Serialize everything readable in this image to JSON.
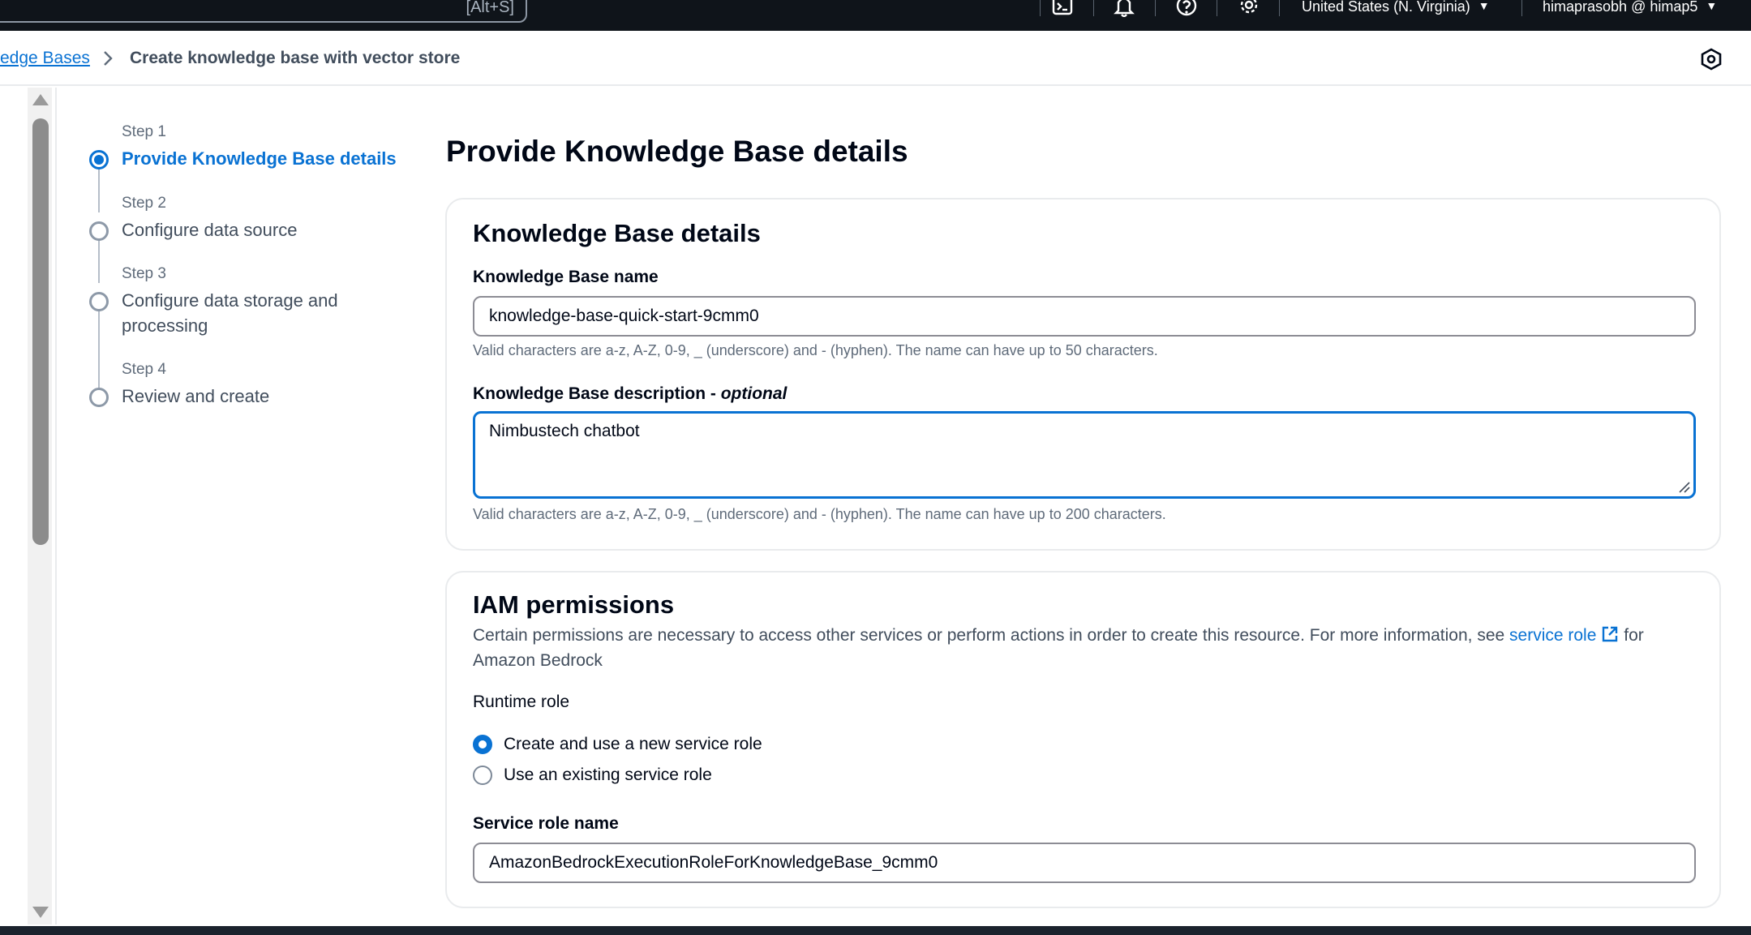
{
  "topbar": {
    "search_shortcut": "[Alt+S]",
    "region": "United States (N. Virginia)",
    "account": "himaprasobh @ himap5",
    "icons": [
      "cloudshell-icon",
      "bell-icon",
      "help-icon",
      "gear-icon"
    ]
  },
  "breadcrumb": {
    "parent": "edge Bases",
    "current": "Create knowledge base with vector store"
  },
  "steps": [
    {
      "label": "Step 1",
      "title": "Provide Knowledge Base details",
      "active": true
    },
    {
      "label": "Step 2",
      "title": "Configure data source",
      "active": false
    },
    {
      "label": "Step 3",
      "title": "Configure data storage and processing",
      "active": false
    },
    {
      "label": "Step 4",
      "title": "Review and create",
      "active": false
    }
  ],
  "page": {
    "title": "Provide Knowledge Base details"
  },
  "details_panel": {
    "title": "Knowledge Base details",
    "name_label": "Knowledge Base name",
    "name_value": "knowledge-base-quick-start-9cmm0",
    "name_hint": "Valid characters are a-z, A-Z, 0-9, _ (underscore) and - (hyphen). The name can have up to 50 characters.",
    "description_label": "Knowledge Base description - ",
    "description_optional": "optional",
    "description_value": "Nimbustech chatbot",
    "description_hint": "Valid characters are a-z, A-Z, 0-9, _ (underscore) and - (hyphen). The name can have up to 200 characters."
  },
  "iam_panel": {
    "title": "IAM permissions",
    "description_before": "Certain permissions are necessary to access other services or perform actions in order to create this resource. For more information, see ",
    "description_link": "service role",
    "description_after": " for Amazon Bedrock",
    "runtime_role_label": "Runtime role",
    "option_new": "Create and use a new service role",
    "option_existing": "Use an existing service role",
    "selected_option": "new",
    "service_role_label": "Service role name",
    "service_role_value": "AmazonBedrockExecutionRoleForKnowledgeBase_9cmm0"
  },
  "colors": {
    "accent": "#0972d3",
    "topbar": "#0f141a",
    "text": "#000716",
    "muted": "#5f6b7a"
  }
}
